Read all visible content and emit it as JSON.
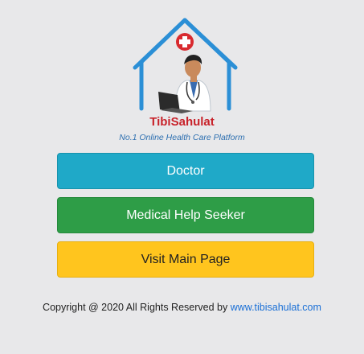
{
  "brand": {
    "name": "TibiSahulat",
    "tagline": "No.1 Online Health Care Platform"
  },
  "buttons": {
    "doctor": "Doctor",
    "seeker": "Medical Help Seeker",
    "main_page": "Visit Main Page"
  },
  "footer": {
    "copyright": "Copyright @ 2020 All Rights Reserved by ",
    "link": "www.tibisahulat.com"
  },
  "colors": {
    "doctor": "#1fa9c8",
    "seeker": "#2e9d47",
    "main_page": "#ffc51e",
    "house": "#2b8fd6",
    "cross": "#d82a2f"
  },
  "icons": {
    "logo": "house-doctor-laptop-logo",
    "medical_cross": "medical-cross-icon"
  }
}
